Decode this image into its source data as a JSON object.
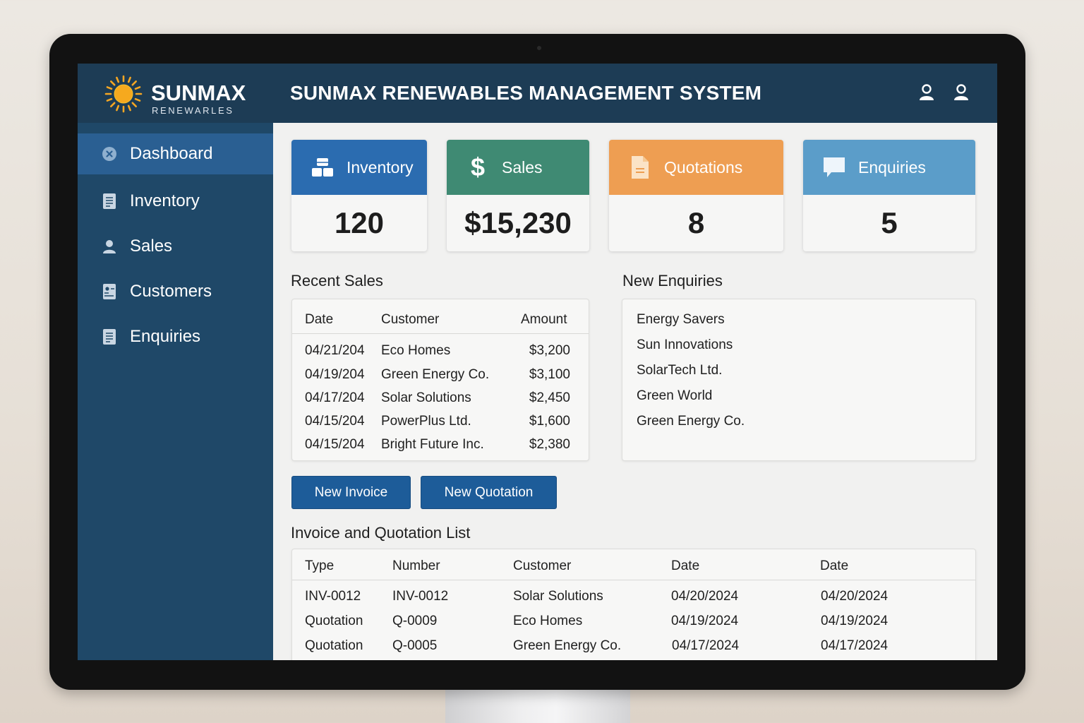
{
  "brand": {
    "name": "SUNMAX",
    "subtitle": "RENEWARLES"
  },
  "header": {
    "title": "SUNMAX RENEWABLES MANAGEMENT SYSTEM"
  },
  "sidebar": {
    "items": [
      {
        "label": "Dashboard",
        "icon": "close-circle-icon",
        "active": true
      },
      {
        "label": "Inventory",
        "icon": "document-icon",
        "active": false
      },
      {
        "label": "Sales",
        "icon": "user-icon",
        "active": false
      },
      {
        "label": "Customers",
        "icon": "contact-card-icon",
        "active": false
      },
      {
        "label": "Enquiries",
        "icon": "document-icon",
        "active": false
      }
    ]
  },
  "cards": [
    {
      "label": "Inventory",
      "value": "120",
      "icon": "boxes-icon",
      "color": "#2b6cb0"
    },
    {
      "label": "Sales",
      "value": "$15,230",
      "icon": "dollar-icon",
      "color": "#3f8a73"
    },
    {
      "label": "Quotations",
      "value": "8",
      "icon": "document-icon",
      "color": "#ee9e52"
    },
    {
      "label": "Enquiries",
      "value": "5",
      "icon": "chat-bubble-icon",
      "color": "#5b9dc9"
    }
  ],
  "recent_sales": {
    "title": "Recent Sales",
    "columns": [
      "Date",
      "Customer",
      "Amount"
    ],
    "rows": [
      [
        "04/21/204",
        "Eco Homes",
        "$3,200"
      ],
      [
        "04/19/204",
        "Green Energy Co.",
        "$3,100"
      ],
      [
        "04/17/204",
        "Solar Solutions",
        "$2,450"
      ],
      [
        "04/15/204",
        "PowerPlus Ltd.",
        "$1,600"
      ],
      [
        "04/15/204",
        "Bright Future Inc.",
        "$2,380"
      ]
    ]
  },
  "new_enquiries": {
    "title": "New Enquiries",
    "items": [
      "Energy Savers",
      "Sun Innovations",
      "SolarTech Ltd.",
      "Green World",
      "Green Energy Co."
    ]
  },
  "actions": {
    "new_invoice": "New Invoice",
    "new_quotation": "New Quotation"
  },
  "invoice_list": {
    "title": "Invoice and Quotation List",
    "columns": [
      "Type",
      "Number",
      "Customer",
      "Date",
      "Date"
    ],
    "rows": [
      [
        "INV-0012",
        "INV-0012",
        "Solar Solutions",
        "04/20/2024",
        "04/20/2024"
      ],
      [
        "Quotation",
        "Q-0009",
        "Eco Homes",
        "04/19/2024",
        "04/19/2024"
      ],
      [
        "Quotation",
        "Q-0005",
        "Green Energy Co.",
        "04/17/2024",
        "04/17/2024"
      ]
    ]
  },
  "colors": {
    "sidebar": "#1f4868",
    "header": "#1d3c55",
    "active_nav": "#2a5f92",
    "button": "#1d5c99",
    "sun": "#f5a623"
  }
}
